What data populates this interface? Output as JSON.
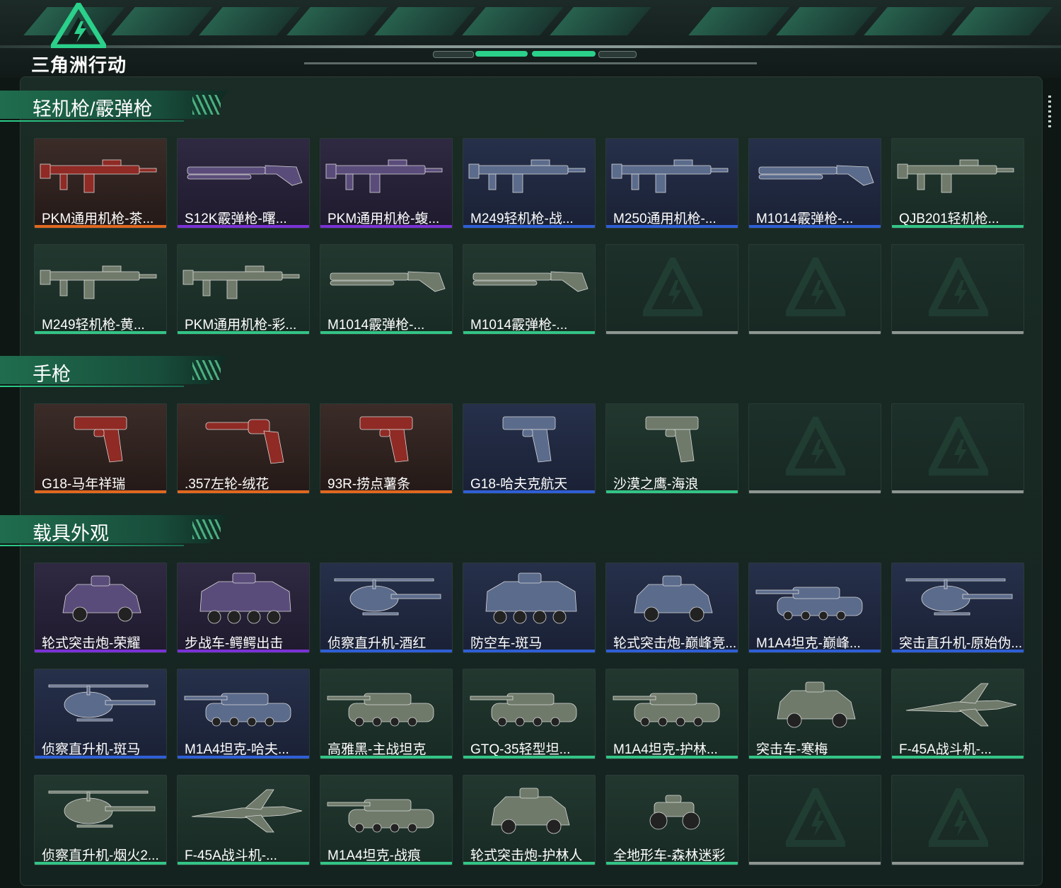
{
  "header": {
    "logo_text": "三角洲行动",
    "accent": "#2bd08a"
  },
  "sections": [
    {
      "title": "轻机枪/霰弹枪",
      "items": [
        {
          "label": "PKM通用机枪-茶...",
          "rarity": "orange",
          "icon": "machine-gun-icon"
        },
        {
          "label": "S12K霰弹枪-曙...",
          "rarity": "purple",
          "icon": "shotgun-icon"
        },
        {
          "label": "PKM通用机枪-蝮...",
          "rarity": "purple",
          "icon": "machine-gun-icon"
        },
        {
          "label": "M249轻机枪-战...",
          "rarity": "blue",
          "icon": "machine-gun-icon"
        },
        {
          "label": "M250通用机枪-...",
          "rarity": "blue",
          "icon": "machine-gun-icon"
        },
        {
          "label": "M1014霰弹枪-...",
          "rarity": "blue",
          "icon": "shotgun-icon"
        },
        {
          "label": "QJB201轻机枪...",
          "rarity": "green",
          "icon": "machine-gun-icon"
        },
        {
          "label": "M249轻机枪-黄...",
          "rarity": "green",
          "icon": "machine-gun-icon"
        },
        {
          "label": "PKM通用机枪-彩...",
          "rarity": "green",
          "icon": "machine-gun-icon"
        },
        {
          "label": "M1014霰弹枪-...",
          "rarity": "green",
          "icon": "shotgun-icon"
        },
        {
          "label": "M1014霰弹枪-...",
          "rarity": "green",
          "icon": "shotgun-icon"
        },
        {
          "label": "",
          "rarity": "empty"
        },
        {
          "label": "",
          "rarity": "empty"
        },
        {
          "label": "",
          "rarity": "empty"
        }
      ]
    },
    {
      "title": "手枪",
      "items": [
        {
          "label": "G18-马年祥瑞",
          "rarity": "orange",
          "icon": "pistol-icon"
        },
        {
          "label": ".357左轮-绒花",
          "rarity": "orange",
          "icon": "revolver-icon"
        },
        {
          "label": "93R-捞点薯条",
          "rarity": "orange",
          "icon": "pistol-icon"
        },
        {
          "label": "G18-哈夫克航天",
          "rarity": "blue",
          "icon": "pistol-icon"
        },
        {
          "label": "沙漠之鹰-海浪",
          "rarity": "green",
          "icon": "pistol-icon"
        },
        {
          "label": "",
          "rarity": "empty"
        },
        {
          "label": "",
          "rarity": "empty"
        }
      ]
    },
    {
      "title": "载具外观",
      "items": [
        {
          "label": "轮式突击炮-荣耀",
          "rarity": "purple",
          "icon": "armored-car-icon"
        },
        {
          "label": "步战车-鳄鳄出击",
          "rarity": "purple",
          "icon": "ifv-icon"
        },
        {
          "label": "侦察直升机-酒红",
          "rarity": "blue",
          "icon": "helicopter-icon"
        },
        {
          "label": "防空车-斑马",
          "rarity": "blue",
          "icon": "ifv-icon"
        },
        {
          "label": "轮式突击炮-巅峰竞...",
          "rarity": "blue",
          "icon": "armored-car-icon"
        },
        {
          "label": "M1A4坦克-巅峰...",
          "rarity": "blue",
          "icon": "tank-icon"
        },
        {
          "label": "突击直升机-原始伪...",
          "rarity": "blue",
          "icon": "helicopter-icon"
        },
        {
          "label": "侦察直升机-斑马",
          "rarity": "blue",
          "icon": "helicopter-icon"
        },
        {
          "label": "M1A4坦克-哈夫...",
          "rarity": "blue",
          "icon": "tank-icon"
        },
        {
          "label": "高雅黑-主战坦克",
          "rarity": "green",
          "icon": "tank-icon"
        },
        {
          "label": "GTQ-35轻型坦...",
          "rarity": "green",
          "icon": "tank-icon"
        },
        {
          "label": "M1A4坦克-护林...",
          "rarity": "green",
          "icon": "tank-icon"
        },
        {
          "label": "突击车-寒梅",
          "rarity": "green",
          "icon": "armored-car-icon"
        },
        {
          "label": "F-45A战斗机-...",
          "rarity": "green",
          "icon": "jet-icon"
        },
        {
          "label": "侦察直升机-烟火2...",
          "rarity": "green",
          "icon": "helicopter-icon"
        },
        {
          "label": "F-45A战斗机-...",
          "rarity": "green",
          "icon": "jet-icon"
        },
        {
          "label": "M1A4坦克-战痕",
          "rarity": "green",
          "icon": "tank-icon"
        },
        {
          "label": "轮式突击炮-护林人",
          "rarity": "green",
          "icon": "armored-car-icon"
        },
        {
          "label": "全地形车-森林迷彩",
          "rarity": "green",
          "icon": "atv-icon"
        },
        {
          "label": "",
          "rarity": "empty"
        },
        {
          "label": "",
          "rarity": "empty"
        }
      ]
    }
  ]
}
